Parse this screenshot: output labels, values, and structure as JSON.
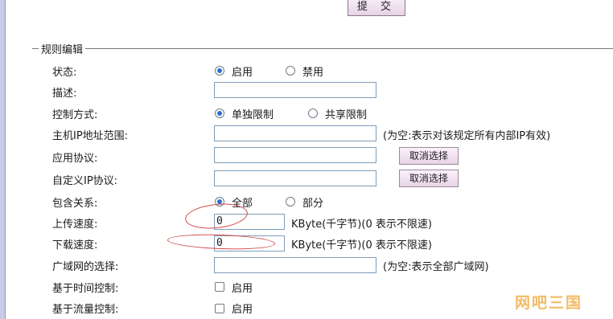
{
  "toolbar": {
    "submit_label": "提 交"
  },
  "section": {
    "title": "规则编辑"
  },
  "rows": {
    "status": {
      "label": "状态:",
      "opt1": "启用",
      "opt2": "禁用"
    },
    "description": {
      "label": "描述:",
      "value": ""
    },
    "control_mode": {
      "label": "控制方式:",
      "opt1": "单独限制",
      "opt2": "共享限制"
    },
    "host_ip_range": {
      "label": "主机IP地址范围:",
      "value": "",
      "hint": "(为空:表示对该规定所有内部IP有效)"
    },
    "app_protocol": {
      "label": "应用协议:",
      "value": "",
      "button": "取消选择"
    },
    "custom_ip_protocol": {
      "label": "自定义IP协议:",
      "value": "",
      "button": "取消选择"
    },
    "include_relation": {
      "label": "包含关系:",
      "opt1": "全部",
      "opt2": "部分"
    },
    "upload_speed": {
      "label": "上传速度:",
      "value": "0",
      "hint": "KByte(千字节)(0 表示不限速)"
    },
    "download_speed": {
      "label": "下载速度:",
      "value": "0",
      "hint": "KByte(千字节)(0 表示不限速)"
    },
    "wan_select": {
      "label": "广域网的选择:",
      "value": "",
      "hint": "(为空:表示全部广域网)"
    },
    "time_control": {
      "label": "基于时间控制:",
      "opt": "启用"
    },
    "traffic_control": {
      "label": "基于流量控制:",
      "opt": "启用"
    }
  },
  "watermark": "网吧三国",
  "colors": {
    "radio_checked": "#2d6fc9",
    "annotation": "#d24848",
    "watermark": "#f0b04a"
  }
}
